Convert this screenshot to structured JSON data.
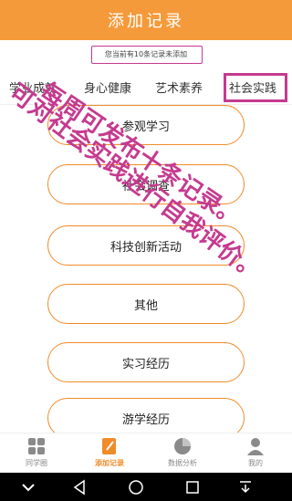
{
  "header": {
    "title": "添加记录"
  },
  "notice": {
    "text": "您当前有10条记录未添加"
  },
  "tabs": [
    {
      "label": "学业成就"
    },
    {
      "label": "身心健康"
    },
    {
      "label": "艺术素养"
    },
    {
      "label": "社会实践"
    }
  ],
  "categories": [
    {
      "label": "参观学习"
    },
    {
      "label": "社会调查"
    },
    {
      "label": "科技创新活动"
    },
    {
      "label": "其他"
    },
    {
      "label": "实习经历"
    },
    {
      "label": "游学经历"
    }
  ],
  "annotation": {
    "line1": "每周可发布十条记录。",
    "line2": "可对社会实践进行自我评价。"
  },
  "tabbar": [
    {
      "label": "同学圈"
    },
    {
      "label": "添加记录"
    },
    {
      "label": "数据分析"
    },
    {
      "label": "我的"
    }
  ],
  "colors": {
    "accent": "#f59a3a",
    "annotation": "#c53a8f",
    "button_border": "#f08b2a"
  }
}
